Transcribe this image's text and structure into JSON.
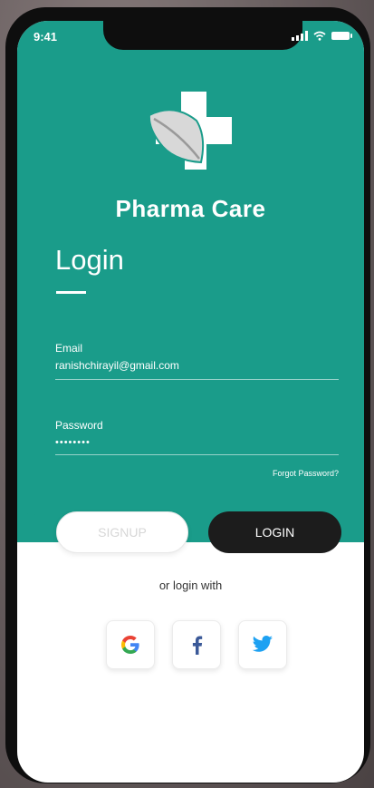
{
  "status_bar": {
    "time": "9:41"
  },
  "app": {
    "name": "Pharma Care"
  },
  "login": {
    "title": "Login",
    "email": {
      "label": "Email",
      "value": "ranishchirayil@gmail.com"
    },
    "password": {
      "label": "Password",
      "value": "••••••••"
    },
    "forgot_label": "Forgot Password?",
    "signup_label": "SIGNUP",
    "login_label": "LOGIN",
    "alt_text": "or login with"
  },
  "social": [
    {
      "icon": "google-icon"
    },
    {
      "icon": "facebook-icon"
    },
    {
      "icon": "twitter-icon"
    }
  ],
  "colors": {
    "primary": "#1a9c8a",
    "dark_button": "#1c1c1c",
    "facebook": "#3b5998",
    "twitter": "#1da1f2"
  }
}
